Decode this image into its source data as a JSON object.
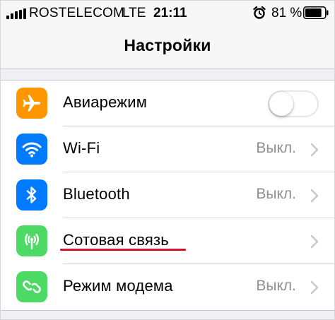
{
  "status_bar": {
    "carrier": "ROSTELECOM",
    "network": "LTE",
    "time": "21:11",
    "battery_percent": "81 %",
    "battery_level": 0.81,
    "signal_bars": 5,
    "alarm_icon": "alarm-clock-icon"
  },
  "nav": {
    "title": "Настройки"
  },
  "settings": [
    {
      "label": "Авиарежим",
      "value": "",
      "icon": "airplane-icon",
      "color": "#ff9500",
      "control": "toggle",
      "toggle_on": false
    },
    {
      "label": "Wi-Fi",
      "value": "Выкл.",
      "icon": "wifi-icon",
      "color": "#007aff",
      "control": "chevron"
    },
    {
      "label": "Bluetooth",
      "value": "Выкл.",
      "icon": "bluetooth-icon",
      "color": "#007aff",
      "control": "chevron"
    },
    {
      "label": "Сотовая связь",
      "value": "",
      "icon": "cellular-icon",
      "color": "#4cd964",
      "control": "chevron",
      "highlighted": true
    },
    {
      "label": "Режим модема",
      "value": "Выкл.",
      "icon": "personal-hotspot-icon",
      "color": "#4cd964",
      "control": "chevron"
    }
  ],
  "colors": {
    "highlight_underline": "#d0142e",
    "secondary_text": "#8e8e93"
  }
}
